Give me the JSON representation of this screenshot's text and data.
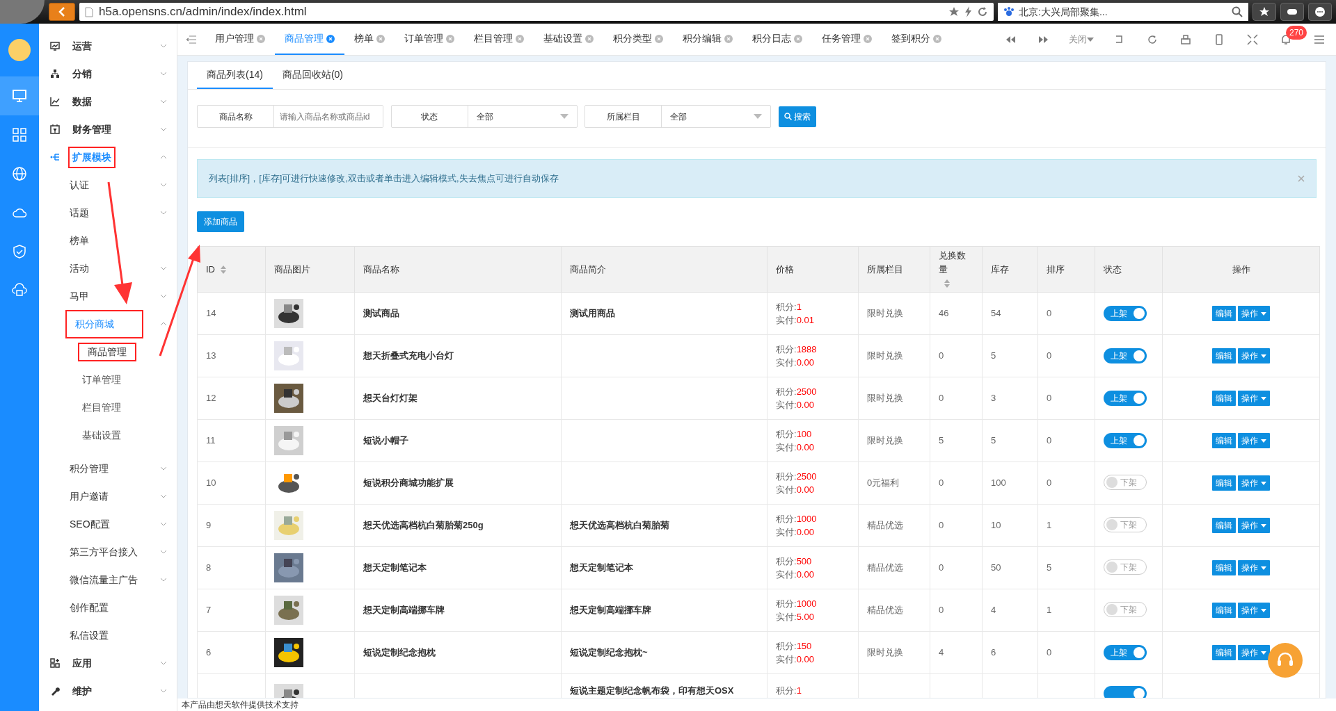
{
  "browser": {
    "url": "h5a.opensns.cn/admin/index/index.html",
    "search": "北京:大兴局部聚集..."
  },
  "rail": [
    {
      "kind": "monitor",
      "selected": true
    },
    {
      "kind": "grid",
      "selected": false
    },
    {
      "kind": "globe",
      "selected": false
    },
    {
      "kind": "cloud",
      "selected": false
    },
    {
      "kind": "shield",
      "selected": false
    },
    {
      "kind": "cloudbox",
      "selected": false
    }
  ],
  "sidebar": {
    "items": [
      {
        "label": "运营",
        "expanded": false
      },
      {
        "label": "分销",
        "expanded": false
      },
      {
        "label": "数据",
        "expanded": false
      },
      {
        "label": "财务管理",
        "expanded": false
      },
      {
        "label": "扩展模块",
        "expanded": true,
        "highlighted": true,
        "children": [
          {
            "label": "认证",
            "expanded": false
          },
          {
            "label": "话题",
            "expanded": false
          },
          {
            "label": "榜单"
          },
          {
            "label": "活动",
            "expanded": false
          },
          {
            "label": "马甲",
            "expanded": false
          },
          {
            "label": "积分商城",
            "expanded": true,
            "highlighted": true,
            "children": [
              {
                "label": "商品管理",
                "selected": true,
                "highlighted": true
              },
              {
                "label": "订单管理",
                "selected": false
              },
              {
                "label": "栏目管理",
                "selected": false
              },
              {
                "label": "基础设置",
                "selected": false
              }
            ]
          },
          {
            "label": "积分管理",
            "expanded": false
          },
          {
            "label": "用户邀请",
            "expanded": false
          },
          {
            "label": "SEO配置",
            "expanded": false
          },
          {
            "label": "第三方平台接入",
            "expanded": false
          },
          {
            "label": "微信流量主广告",
            "expanded": false
          },
          {
            "label": "创作配置"
          },
          {
            "label": "私信设置"
          }
        ]
      },
      {
        "label": "应用",
        "expanded": false
      },
      {
        "label": "维护",
        "expanded": false
      }
    ]
  },
  "tabs": [
    {
      "label": "用户管理",
      "selected": false
    },
    {
      "label": "商品管理",
      "selected": true
    },
    {
      "label": "榜单",
      "selected": false
    },
    {
      "label": "订单管理",
      "selected": false
    },
    {
      "label": "栏目管理",
      "selected": false
    },
    {
      "label": "基础设置",
      "selected": false
    },
    {
      "label": "积分类型",
      "selected": false
    },
    {
      "label": "积分编辑",
      "selected": false
    },
    {
      "label": "积分日志",
      "selected": false
    },
    {
      "label": "任务管理",
      "selected": false
    },
    {
      "label": "签到积分",
      "selected": false
    }
  ],
  "toolbar": {
    "close_menu": "关闭",
    "notifications": "270"
  },
  "subtabs": [
    {
      "label": "商品列表(14)",
      "selected": true
    },
    {
      "label": "商品回收站(0)",
      "selected": false
    }
  ],
  "filters": [
    {
      "label": "商品名称",
      "kind": "text",
      "placeholder": "请输入商品名称或商品id"
    },
    {
      "label": "状态",
      "kind": "select",
      "value": "全部"
    },
    {
      "label": "所属栏目",
      "kind": "select",
      "value": "全部"
    }
  ],
  "search_button": "搜索",
  "alert": "列表[排序]，[库存]可进行快速修改,双击或者单击进入编辑模式,失去焦点可进行自动保存",
  "add_button": "添加商品",
  "table": {
    "columns": [
      {
        "label": "ID",
        "sortable": true
      },
      {
        "label": "商品图片",
        "sortable": false
      },
      {
        "label": "商品名称",
        "sortable": false
      },
      {
        "label": "商品简介",
        "sortable": false
      },
      {
        "label": "价格",
        "sortable": false
      },
      {
        "label": "所属栏目",
        "sortable": false
      },
      {
        "label": "兑换数量",
        "sortable": true
      },
      {
        "label": "库存",
        "sortable": false
      },
      {
        "label": "排序",
        "sortable": false
      },
      {
        "label": "状态",
        "sortable": false
      },
      {
        "label": "操作",
        "sortable": false
      }
    ],
    "rows": [
      {
        "id": "14",
        "name": "测试商品",
        "intro": "测试用商品",
        "points_label": "积分:",
        "points": "1",
        "paid_label": "实付:",
        "paid": "0.01",
        "category": "限时兑换",
        "exchanged": "46",
        "stock": "54",
        "sort": "0",
        "on": true,
        "status": "上架",
        "edit": "编辑",
        "ops": "操作"
      },
      {
        "id": "13",
        "name": "想天折叠式充电小台灯",
        "points_label": "积分:",
        "points": "1888",
        "paid_label": "实付:",
        "paid": "0.00",
        "category": "限时兑换",
        "exchanged": "0",
        "stock": "5",
        "sort": "0",
        "on": true,
        "status": "上架",
        "edit": "编辑",
        "ops": "操作"
      },
      {
        "id": "12",
        "name": "想天台灯灯架",
        "points_label": "积分:",
        "points": "2500",
        "paid_label": "实付:",
        "paid": "0.00",
        "category": "限时兑换",
        "exchanged": "0",
        "stock": "3",
        "sort": "0",
        "on": true,
        "status": "上架",
        "edit": "编辑",
        "ops": "操作"
      },
      {
        "id": "11",
        "name": "短说小帽子",
        "points_label": "积分:",
        "points": "100",
        "paid_label": "实付:",
        "paid": "0.00",
        "category": "限时兑换",
        "exchanged": "5",
        "stock": "5",
        "sort": "0",
        "on": true,
        "status": "上架",
        "edit": "编辑",
        "ops": "操作"
      },
      {
        "id": "10",
        "name": "短说积分商城功能扩展",
        "points_label": "积分:",
        "points": "2500",
        "paid_label": "实付:",
        "paid": "0.00",
        "category": "0元福利",
        "exchanged": "0",
        "stock": "100",
        "sort": "0",
        "on": false,
        "status": "下架",
        "edit": "编辑",
        "ops": "操作"
      },
      {
        "id": "9",
        "name": "想天优选高档杭白菊胎菊250g",
        "intro": "想天优选高档杭白菊胎菊",
        "points_label": "积分:",
        "points": "1000",
        "paid_label": "实付:",
        "paid": "0.00",
        "category": "精品优选",
        "exchanged": "0",
        "stock": "10",
        "sort": "1",
        "on": false,
        "status": "下架",
        "edit": "编辑",
        "ops": "操作"
      },
      {
        "id": "8",
        "name": "想天定制笔记本",
        "intro": "想天定制笔记本",
        "points_label": "积分:",
        "points": "500",
        "paid_label": "实付:",
        "paid": "0.00",
        "category": "精品优选",
        "exchanged": "0",
        "stock": "50",
        "sort": "5",
        "on": false,
        "status": "下架",
        "edit": "编辑",
        "ops": "操作"
      },
      {
        "id": "7",
        "name": "想天定制高端挪车牌",
        "intro": "想天定制高端挪车牌",
        "points_label": "积分:",
        "points": "1000",
        "paid_label": "实付:",
        "paid": "5.00",
        "category": "精品优选",
        "exchanged": "0",
        "stock": "4",
        "sort": "1",
        "on": false,
        "status": "下架",
        "edit": "编辑",
        "ops": "操作"
      },
      {
        "id": "6",
        "name": "短说定制纪念抱枕",
        "intro": "短说定制纪念抱枕~",
        "points_label": "积分:",
        "points": "150",
        "paid_label": "实付:",
        "paid": "0.00",
        "category": "限时兑换",
        "exchanged": "4",
        "stock": "6",
        "sort": "0",
        "on": true,
        "status": "上架",
        "edit": "编辑",
        "ops": "操作"
      },
      {
        "intro": "短说主题定制纪念帆布袋，印有想天OSX",
        "points_label": "积分:",
        "points": "1",
        "on": true
      }
    ]
  },
  "footer": "本产品由想天软件提供技术支持"
}
